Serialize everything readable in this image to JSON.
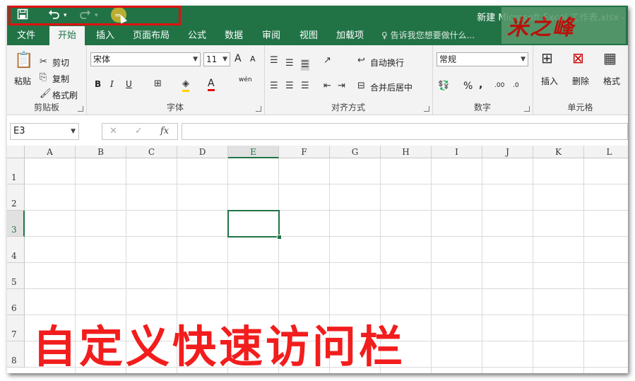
{
  "qat": {
    "save_icon": "save-icon",
    "undo_icon": "undo-icon",
    "redo_icon": "redo-icon",
    "customize_icon": "customize-qat-icon"
  },
  "window": {
    "title": "新建 Microsoft Excel 工作表.xlsx -"
  },
  "logo": {
    "text": "米之峰"
  },
  "tabs": [
    "文件",
    "开始",
    "插入",
    "页面布局",
    "公式",
    "数据",
    "审阅",
    "视图",
    "加载项"
  ],
  "active_tab": "开始",
  "tell_me": "告诉我您想要做什么...",
  "clipboard": {
    "label": "剪贴板",
    "paste": "粘贴",
    "cut": "剪切",
    "copy": "复制",
    "format_painter": "格式刷"
  },
  "font": {
    "label": "字体",
    "name": "宋体",
    "size": "11",
    "bold": "B",
    "italic": "I",
    "underline": "U",
    "grow": "A",
    "shrink": "A",
    "phonetic": "wén"
  },
  "alignment": {
    "label": "对齐方式",
    "wrap": "自动换行",
    "merge": "合并后居中"
  },
  "number": {
    "label": "数字",
    "format": "常规",
    "percent": "%",
    "comma": ",",
    "inc_decimal": ".00",
    "dec_decimal": ".0"
  },
  "cells": {
    "label": "单元格",
    "insert": "插入",
    "delete": "删除",
    "format": "格式"
  },
  "formula_bar": {
    "name_box": "E3",
    "cancel": "✕",
    "enter": "✓",
    "fx": "fx",
    "value": ""
  },
  "columns": [
    "A",
    "B",
    "C",
    "D",
    "E",
    "F",
    "G",
    "H",
    "I",
    "J",
    "K",
    "L"
  ],
  "rows": [
    "1",
    "2",
    "3",
    "4",
    "5",
    "6",
    "7",
    "8"
  ],
  "selected_cell": {
    "column": "E",
    "row": "3"
  },
  "caption": "自定义快速访问栏",
  "colors": {
    "excel_green": "#217346",
    "highlight_red": "#e01010",
    "caption_red": "#f21d1d"
  }
}
